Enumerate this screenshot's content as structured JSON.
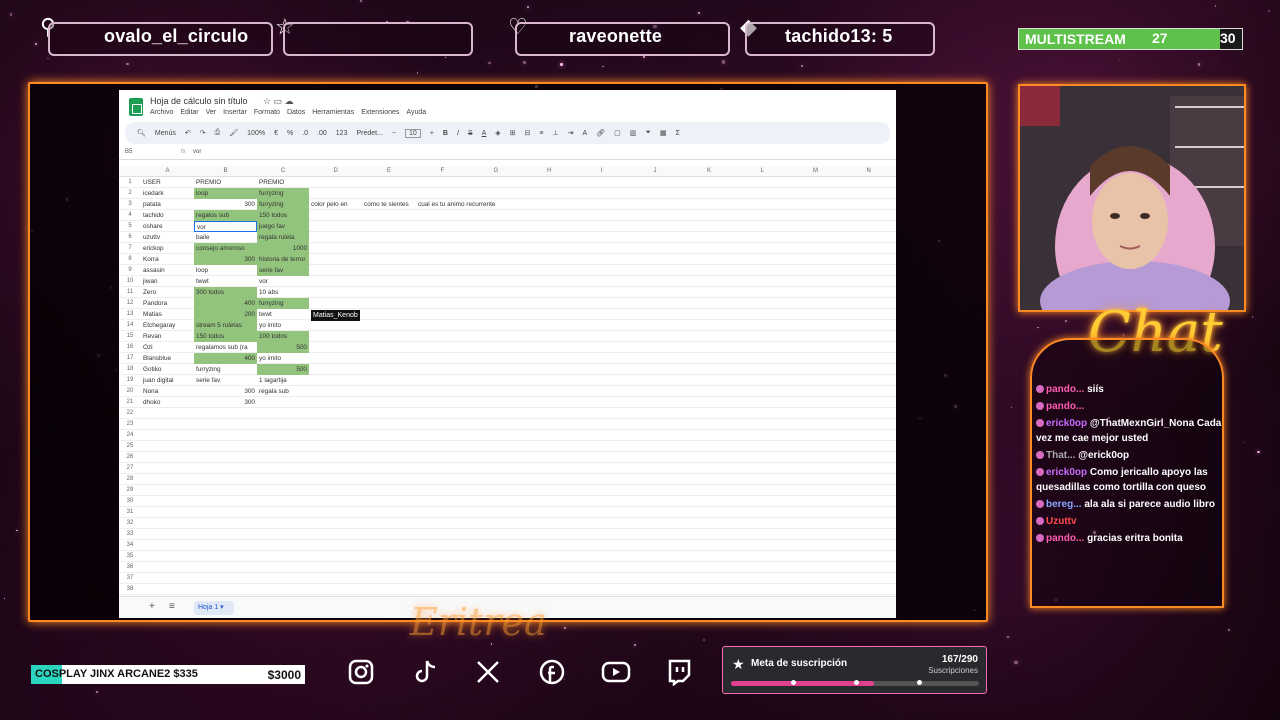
{
  "topbar": {
    "follower": "ovalo_el_circulo",
    "subscriber": "raveonette",
    "donation": "tachido13: 5",
    "multistream_label": "MULTISTREAM",
    "multistream_value": "27",
    "multistream_goal": "30",
    "multistream_progress": 0.9
  },
  "sheet": {
    "title": "Hoja de cálculo sin título",
    "menu": [
      "Archivo",
      "Editar",
      "Ver",
      "Insertar",
      "Formato",
      "Datos",
      "Herramientas",
      "Extensiones",
      "Ayuda"
    ],
    "toolbar": {
      "menus": "Menús",
      "zoom": "100%",
      "format": "Predet...",
      "font_size": "10"
    },
    "cell_ref": "B5",
    "formula_value": "vor",
    "columns": [
      "A",
      "B",
      "C",
      "D",
      "E",
      "F",
      "G",
      "H",
      "I",
      "J",
      "K",
      "L",
      "M",
      "N"
    ],
    "rows": [
      {
        "a": "USER",
        "b": "PREMIO",
        "c": "PREMIO"
      },
      {
        "a": "icedark",
        "b": "loop",
        "c": "furryzing"
      },
      {
        "a": "patata",
        "b": "300",
        "c": "furryzing",
        "d": "color pelo en",
        "e": "como te sientes",
        "f": "cual es tu animo recurrente"
      },
      {
        "a": "tachido",
        "b": "regalos sub",
        "c": "150 todos"
      },
      {
        "a": "oshare",
        "b": "vor",
        "c": "juego fav"
      },
      {
        "a": "uzuttv",
        "b": "baile",
        "c": "regala ruleta"
      },
      {
        "a": "erickop",
        "b": "consejo amoroso",
        "c": "1000"
      },
      {
        "a": "Korra",
        "b": "300",
        "c": "historia de terror"
      },
      {
        "a": "assasin",
        "b": "loop",
        "c": "serie fav"
      },
      {
        "a": "jiwan",
        "b": "twwt",
        "c": "vor"
      },
      {
        "a": "Zero",
        "b": "300 todos",
        "c": "10 abs"
      },
      {
        "a": "Pandora",
        "b": "400",
        "c": "furryzing"
      },
      {
        "a": "Matias",
        "b": "200",
        "c": "twwt"
      },
      {
        "a": "Etchegaray",
        "b": "stream 5 ruletas",
        "c": "yo imito"
      },
      {
        "a": "Revan",
        "b": "150 todos",
        "c": "100 todos"
      },
      {
        "a": "Ozi",
        "b": "regalamos sub (ra",
        "c": "500"
      },
      {
        "a": "Blansblue",
        "b": "400",
        "c": "yo imito"
      },
      {
        "a": "Gotiko",
        "b": "furryzing",
        "c": "500"
      },
      {
        "a": "juan digital",
        "b": "serie fav",
        "c": "1 lagartija"
      },
      {
        "a": "Nona",
        "b": "300",
        "c": "regala sub"
      },
      {
        "a": "dhoko",
        "b": "300",
        "c": ""
      }
    ],
    "tooltip": "Matias_Kenob",
    "sheet_tab": "Hoja 1"
  },
  "chat": {
    "title": "Chat",
    "messages": [
      {
        "user": "pando...",
        "text": "siís",
        "cls": "u2"
      },
      {
        "user": "pando...",
        "text": "",
        "cls": "u2"
      },
      {
        "user": "erick0op",
        "text": "@ThatMexnGirl_Nona Cada vez me cae mejor usted",
        "cls": "u"
      },
      {
        "user": "That...",
        "text": "@erick0op",
        "cls": "u4"
      },
      {
        "user": "erick0op",
        "text": "Como jericallo apoyo las quesadillas como tortilla con queso",
        "cls": "u"
      },
      {
        "user": "bereg...",
        "text": "ala ala si parece audio libro",
        "cls": "u3"
      },
      {
        "user": "Uzuttv",
        "text": "",
        "cls": "u5"
      },
      {
        "user": "pando...",
        "text": "gracias eritra bonita",
        "cls": "u2"
      }
    ]
  },
  "bottom": {
    "cosplay_label": "COSPLAY JINX ARCANE2 $335",
    "cosplay_goal": "$3000",
    "cosplay_progress": 0.112,
    "socials": [
      "instagram-icon",
      "tiktok-icon",
      "x-icon",
      "facebook-icon",
      "youtube-icon",
      "twitch-icon"
    ],
    "sub_goal_title": "Meta de suscripción",
    "sub_goal_count": "167/290",
    "sub_goal_label": "Suscripciones",
    "sub_goal_progress": 0.576
  }
}
